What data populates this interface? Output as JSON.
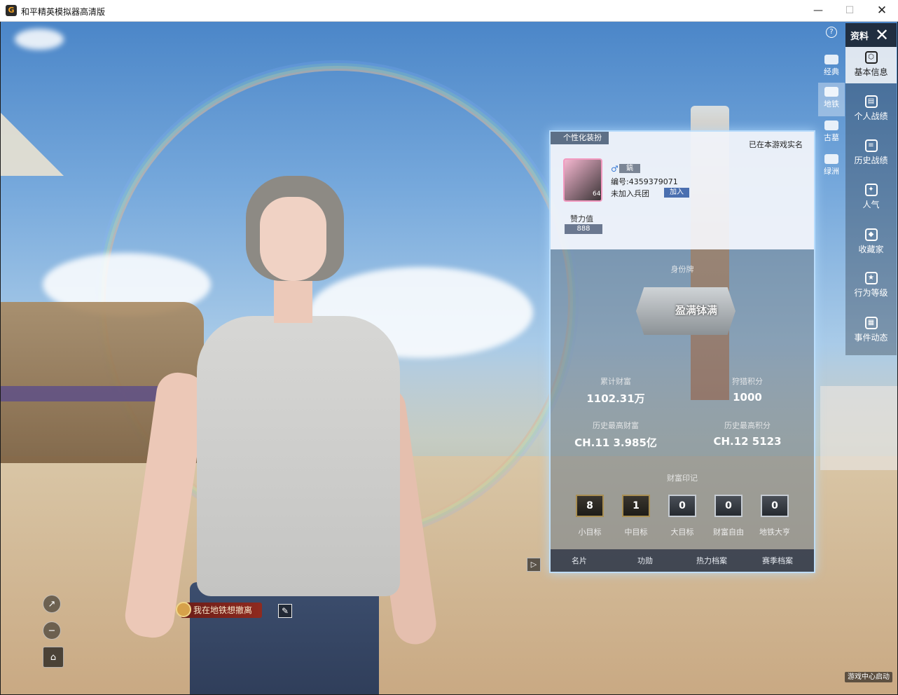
{
  "window": {
    "title": "和平精英模拟器高清版",
    "min_symbol": "—",
    "max_symbol": "☐",
    "close_symbol": "✕"
  },
  "panel": {
    "header_label": "资料",
    "help_symbol": "?",
    "close_symbol": "✕"
  },
  "sidebar": {
    "items": [
      {
        "label": "基本信息",
        "icon": "shield-icon",
        "active": true
      },
      {
        "label": "个人战绩",
        "icon": "stats-icon"
      },
      {
        "label": "历史战绩",
        "icon": "history-icon"
      },
      {
        "label": "人气",
        "icon": "popularity-icon"
      },
      {
        "label": "收藏家",
        "icon": "collector-icon"
      },
      {
        "label": "行为等级",
        "icon": "behavior-icon"
      },
      {
        "label": "事件动态",
        "icon": "events-icon"
      }
    ]
  },
  "subtabs": [
    {
      "label": "经典"
    },
    {
      "label": "地铁",
      "active": true
    },
    {
      "label": "古墓"
    },
    {
      "label": "绿洲"
    }
  ],
  "card": {
    "deco_tab": "个性化装扮",
    "verified": "已在本游戏实名",
    "avatar_level": "64",
    "gender_symbol": "♂",
    "name": "鎬",
    "id_line": "编号:4359379071",
    "clan_line": "未加入兵团",
    "join_label": "加入",
    "likes_label": "赞力值",
    "likes_value": "888",
    "identity_label": "身份牌",
    "identity_badge": "盈满钵满",
    "stats": {
      "wealth_label": "累计财富",
      "wealth_value": "1102.31万",
      "hunt_label": "狩猎积分",
      "hunt_value": "1000",
      "max_wealth_label": "历史最高财富",
      "max_wealth_value": "CH.11 3.985亿",
      "max_score_label": "历史最高积分",
      "max_score_value": "CH.12 5123"
    },
    "marks_label": "财富印记",
    "marks": [
      {
        "value": "8",
        "label": "小目标"
      },
      {
        "value": "1",
        "label": "中目标"
      },
      {
        "value": "0",
        "label": "大目标"
      },
      {
        "value": "0",
        "label": "财富自由"
      },
      {
        "value": "0",
        "label": "地铁大亨"
      }
    ],
    "footer": [
      {
        "label": "名片"
      },
      {
        "label": "功勋"
      },
      {
        "label": "热力档案"
      },
      {
        "label": "赛季档案"
      }
    ],
    "expand_symbol": "▷"
  },
  "player": {
    "banner_text": "我在地铁想撤离"
  },
  "status": "游戏中心启动",
  "colors": {
    "accent": "#4a6fb0",
    "card_glow": "#bee1ff",
    "banner": "#8f2a1f"
  }
}
